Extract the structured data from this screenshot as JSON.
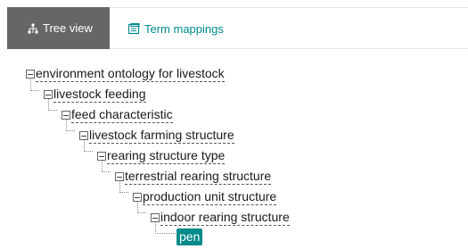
{
  "tabs": {
    "tree_view": "Tree view",
    "term_mappings": "Term mappings"
  },
  "tree": {
    "n0": "environment ontology for livestock",
    "n1": "livestock feeding",
    "n2": "feed characteristic",
    "n3": "livestock farming structure",
    "n4": "rearing structure type",
    "n5": "terrestrial rearing structure",
    "n6": "production unit structure",
    "n7": "indoor rearing structure",
    "selected": "pen"
  },
  "colors": {
    "accent": "#008a8a",
    "active_tab_bg": "#666666"
  }
}
